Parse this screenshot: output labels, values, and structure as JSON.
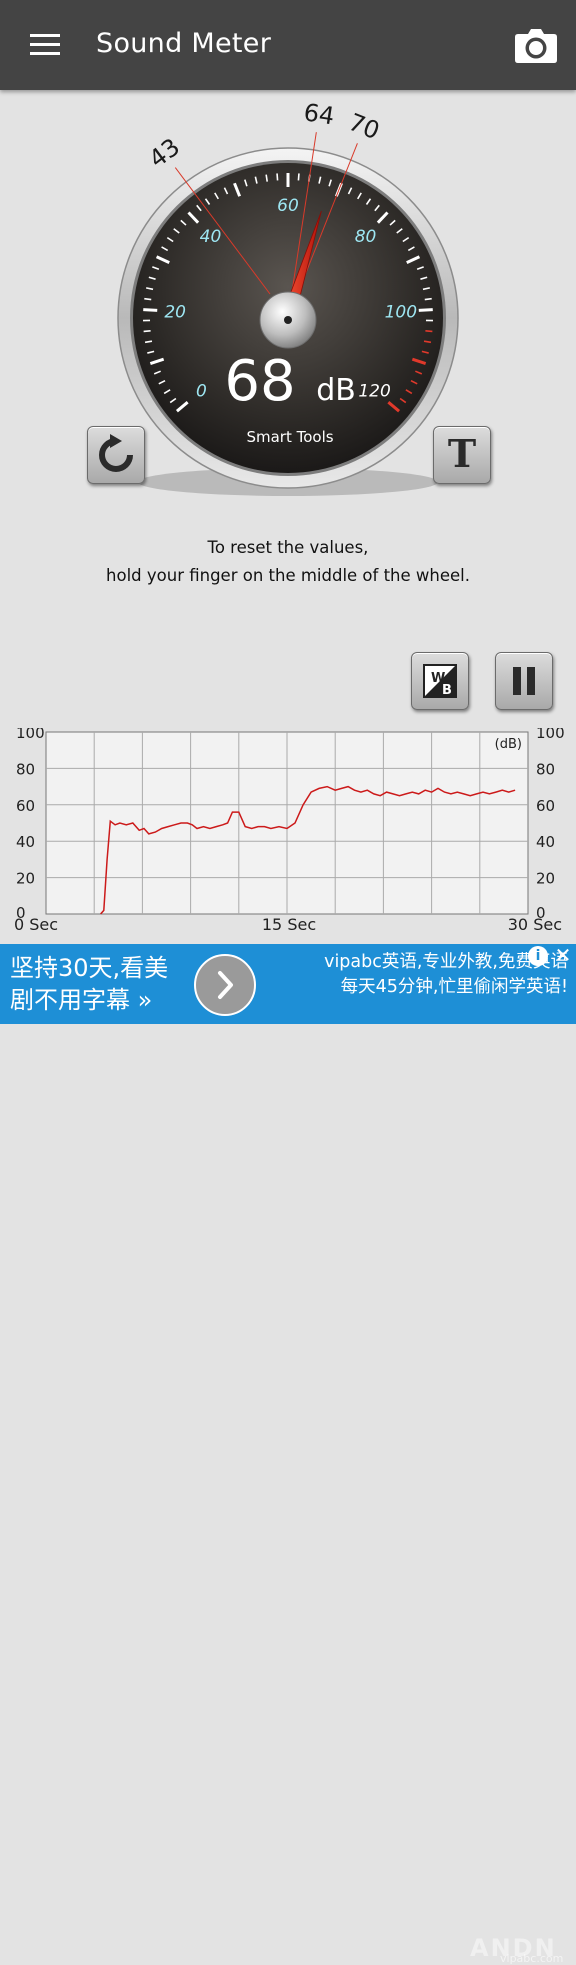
{
  "appbar": {
    "title": "Sound Meter",
    "menu_icon": "hamburger-menu-icon",
    "camera_icon": "camera-icon"
  },
  "gauge": {
    "current_db": "68",
    "unit": "dB",
    "brand": "Smart Tools",
    "scale_labels": [
      "0",
      "20",
      "40",
      "60",
      "80",
      "100",
      "120"
    ],
    "min_marker": "43",
    "avg_marker": "64",
    "max_marker": "70",
    "needle_value": 68,
    "colors": {
      "scale_label": "#9ee6f2",
      "needle": "#e0261a",
      "marker_line": "#d93a2a"
    }
  },
  "controls": {
    "reset_icon": "refresh-icon",
    "text_icon": "text-mode-icon",
    "wb_icon": "white-black-toggle-icon",
    "pause_icon": "pause-icon"
  },
  "hint": {
    "line1": "To reset the values,",
    "line2": "hold your finger on the middle of the wheel."
  },
  "chart_data": {
    "type": "line",
    "ylabel": "(dB)",
    "ylim": [
      0,
      100
    ],
    "yticks_left": [
      "100",
      "80",
      "60",
      "40",
      "20",
      "0"
    ],
    "yticks_right": [
      "100",
      "80",
      "60",
      "40",
      "20",
      "0"
    ],
    "xlim": [
      0,
      30
    ],
    "xtick_labels": [
      "0 Sec",
      "15 Sec",
      "30 Sec"
    ],
    "grid": true,
    "color": "#cc1a1a",
    "series": [
      {
        "x": [
          3.4,
          3.6,
          3.8,
          4.0,
          4.3,
          4.6,
          5.0,
          5.4,
          5.8,
          6.1,
          6.4,
          6.8,
          7.2,
          7.6,
          8.0,
          8.4,
          8.8,
          9.1,
          9.4,
          9.8,
          10.2,
          10.6,
          11.0,
          11.3,
          11.6,
          12.0,
          12.4,
          12.8,
          13.2,
          13.6,
          14.0,
          14.5,
          15.0,
          15.5,
          16.0,
          16.5,
          17.0,
          17.5,
          18.0,
          18.4,
          18.8,
          19.2,
          19.6,
          20.0,
          20.4,
          20.8,
          21.2,
          21.6,
          22.0,
          22.4,
          22.8,
          23.2,
          23.6,
          24.0,
          24.4,
          24.8,
          25.2,
          25.6,
          26.0,
          26.4,
          26.8,
          27.2,
          27.6,
          28.0,
          28.4,
          28.8,
          29.2
        ],
        "y": [
          0,
          2,
          30,
          51,
          49,
          50,
          49,
          50,
          46,
          47,
          44,
          45,
          47,
          48,
          49,
          50,
          50,
          49,
          47,
          48,
          47,
          48,
          49,
          50,
          56,
          56,
          48,
          47,
          48,
          48,
          47,
          48,
          47,
          50,
          60,
          67,
          69,
          70,
          68,
          69,
          70,
          68,
          67,
          68,
          66,
          65,
          67,
          66,
          65,
          66,
          67,
          66,
          68,
          67,
          69,
          67,
          66,
          67,
          66,
          65,
          66,
          67,
          66,
          67,
          68,
          67,
          68
        ]
      }
    ]
  },
  "ad": {
    "left_line1": "坚持30天,看美",
    "left_line2": "剧不用字幕 »",
    "right_line1": "vipabc英语,专业外教,免费英语",
    "right_line2": "每天45分钟,忙里偷闲学英语!",
    "info_label": "i",
    "close_label": "✕",
    "watermark": "ANDN",
    "watermark_sub": "vipabc.com"
  }
}
